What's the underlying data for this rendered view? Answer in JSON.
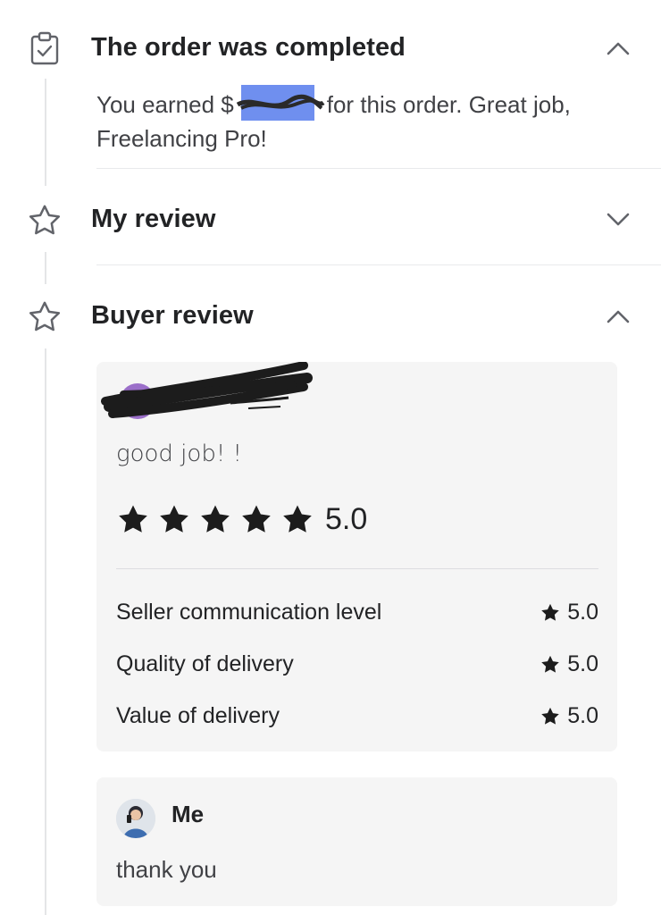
{
  "order_completed": {
    "title": "The order was completed",
    "message_before": "You earned $",
    "message_after": "for this order. Great job,",
    "message_line2": "Freelancing Pro!",
    "icon": "clipboard-check-icon",
    "expanded": true
  },
  "my_review": {
    "title": "My review",
    "icon": "star-outline-icon",
    "expanded": false
  },
  "buyer_review": {
    "title": "Buyer review",
    "icon": "star-outline-icon",
    "expanded": true,
    "comment": "good job! !",
    "overall_rating": "5.0",
    "stars_filled": 5,
    "criteria": [
      {
        "label": "Seller communication level",
        "score": "5.0"
      },
      {
        "label": "Quality of delivery",
        "score": "5.0"
      },
      {
        "label": "Value of delivery",
        "score": "5.0"
      }
    ],
    "reply": {
      "author": "Me",
      "text": "thank you"
    }
  },
  "colors": {
    "text_primary": "#222325",
    "text_secondary": "#404145",
    "card_background": "#f5f5f5",
    "redaction_highlight": "#6f8fef"
  }
}
